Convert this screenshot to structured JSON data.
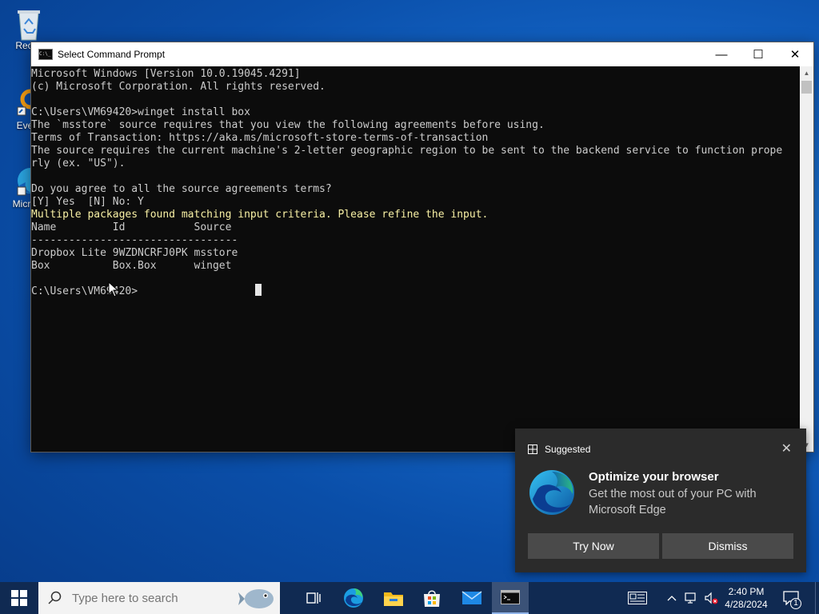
{
  "desktop": {
    "icons": [
      {
        "label": "Recyc",
        "icon": "recycle-bin-icon"
      },
      {
        "label": "Every",
        "icon": "everything-icon"
      },
      {
        "label": "Micr Ed",
        "icon": "edge-icon"
      }
    ]
  },
  "window": {
    "title": "Select Command Prompt",
    "controls": {
      "minimize": "—",
      "maximize": "☐",
      "close": "✕"
    }
  },
  "console": {
    "lines": [
      {
        "text": "Microsoft Windows [Version 10.0.19045.4291]",
        "color": "#cccccc"
      },
      {
        "text": "(c) Microsoft Corporation. All rights reserved.",
        "color": "#cccccc"
      },
      {
        "text": "",
        "color": "#cccccc"
      },
      {
        "text": "C:\\Users\\VM69420>winget install box",
        "color": "#cccccc"
      },
      {
        "text": "The `msstore` source requires that you view the following agreements before using.",
        "color": "#cccccc"
      },
      {
        "text": "Terms of Transaction: https://aka.ms/microsoft-store-terms-of-transaction",
        "color": "#cccccc"
      },
      {
        "text": "The source requires the current machine's 2-letter geographic region to be sent to the backend service to function prope",
        "color": "#cccccc"
      },
      {
        "text": "rly (ex. \"US\").",
        "color": "#cccccc"
      },
      {
        "text": "",
        "color": "#cccccc"
      },
      {
        "text": "Do you agree to all the source agreements terms?",
        "color": "#cccccc"
      },
      {
        "text": "[Y] Yes  [N] No: Y",
        "color": "#cccccc"
      },
      {
        "text": "Multiple packages found matching input criteria. Please refine the input.",
        "color": "#f9f1a5"
      },
      {
        "text": "Name         Id           Source",
        "color": "#cccccc"
      },
      {
        "text": "---------------------------------",
        "color": "#cccccc"
      },
      {
        "text": "Dropbox Lite 9WZDNCRFJ0PK msstore",
        "color": "#cccccc"
      },
      {
        "text": "Box          Box.Box      winget",
        "color": "#cccccc"
      },
      {
        "text": "",
        "color": "#cccccc"
      },
      {
        "text": "C:\\Users\\VM69420>",
        "color": "#cccccc"
      }
    ]
  },
  "toast": {
    "header": "Suggested",
    "title": "Optimize your browser",
    "body": "Get the most out of your PC with Microsoft Edge",
    "primary_button": "Try Now",
    "secondary_button": "Dismiss",
    "close_label": "✕"
  },
  "taskbar": {
    "search_placeholder": "Type here to search",
    "clock_time": "2:40 PM",
    "clock_date": "4/28/2024",
    "notification_count": "1",
    "apps": [
      "task-view-icon",
      "edge-icon",
      "file-explorer-icon",
      "microsoft-store-icon",
      "mail-icon",
      "command-prompt-icon"
    ]
  }
}
